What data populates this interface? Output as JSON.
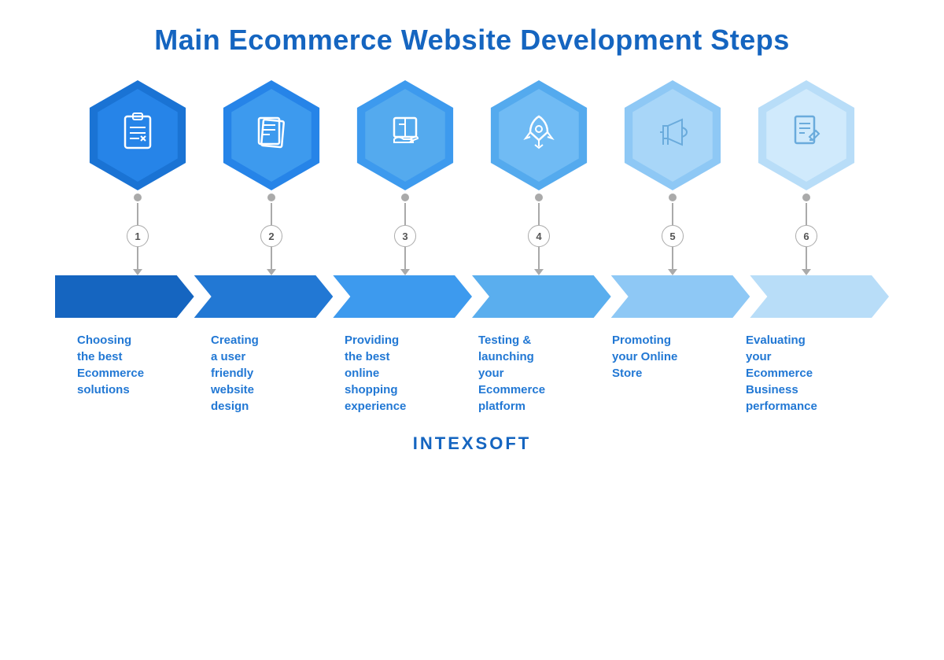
{
  "title": "Main Ecommerce Website Development Steps",
  "steps": [
    {
      "number": "1",
      "icon": "📋",
      "icon_svg": "clipboard",
      "label": "Choosing\nthe best\nEcommerce\nsolutions"
    },
    {
      "number": "2",
      "icon": "📄",
      "icon_svg": "documents",
      "label": "Creating\na user\nfriendly\nwebsite\ndesign"
    },
    {
      "number": "3",
      "icon": "📦",
      "icon_svg": "box-hand",
      "label": "Providing\nthe best\nonline\nshopping\nexperience"
    },
    {
      "number": "4",
      "icon": "🚀",
      "icon_svg": "rocket",
      "label": "Testing &\nlaunching\nyour\nEcommerce\nplatform"
    },
    {
      "number": "5",
      "icon": "📢",
      "icon_svg": "megaphone",
      "label": "Promoting\nyour Online\nStore"
    },
    {
      "number": "6",
      "icon": "📝",
      "icon_svg": "document-pencil",
      "label": "Evaluating\nyour\nEcommerce\nBusiness\nperformance"
    }
  ],
  "logo": "INTEXSOFT",
  "colors": {
    "title": "#1565c0",
    "label": "#2278d4"
  }
}
